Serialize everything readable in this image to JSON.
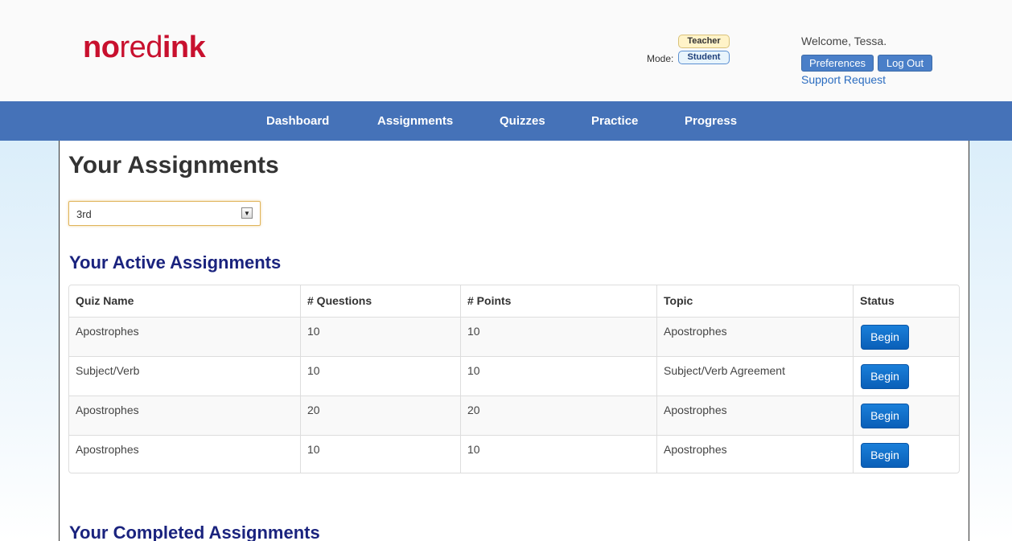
{
  "header": {
    "logo": {
      "part1": "no",
      "part2": "red",
      "part3": "ink"
    },
    "mode_label": "Mode:",
    "mode_teacher": "Teacher",
    "mode_student": "Student",
    "welcome": "Welcome, Tessa.",
    "preferences_label": "Preferences",
    "logout_label": "Log Out",
    "support_label": "Support Request"
  },
  "nav": {
    "items": [
      "Dashboard",
      "Assignments",
      "Quizzes",
      "Practice",
      "Progress"
    ]
  },
  "main": {
    "title": "Your Assignments",
    "period_select": {
      "value": "3rd"
    },
    "active_title": "Your Active Assignments",
    "completed_title": "Your Completed Assignments",
    "table": {
      "columns": [
        "Quiz Name",
        "# Questions",
        "# Points",
        "Topic",
        "Status"
      ],
      "rows": [
        {
          "name": "Apostrophes",
          "questions": "10",
          "points": "10",
          "topic": "Apostrophes",
          "status": "Begin"
        },
        {
          "name": "Subject/Verb",
          "questions": "10",
          "points": "10",
          "topic": "Subject/Verb Agreement",
          "status": "Begin"
        },
        {
          "name": "Apostrophes",
          "questions": "20",
          "points": "20",
          "topic": "Apostrophes",
          "status": "Begin"
        },
        {
          "name": "Apostrophes",
          "questions": "10",
          "points": "10",
          "topic": "Apostrophes",
          "status": "Begin"
        }
      ]
    }
  },
  "colors": {
    "brand_red": "#c8102e",
    "nav_blue": "#4572b8",
    "section_title": "#1a237e",
    "begin_button": "#1a7fd9"
  }
}
